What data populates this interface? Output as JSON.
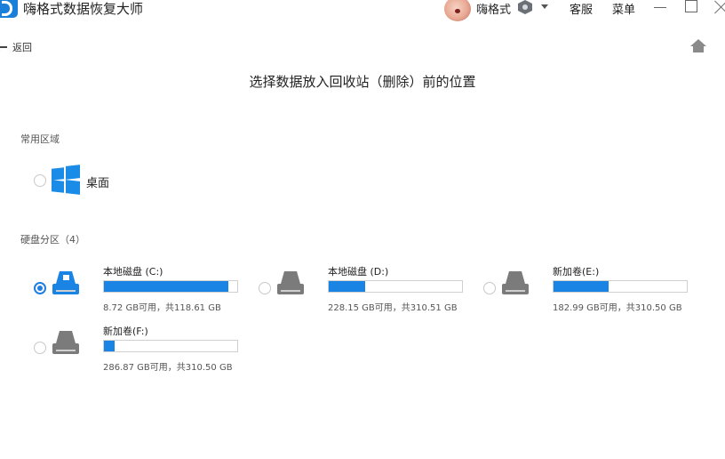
{
  "app": {
    "title": "嗨格式数据恢复大师"
  },
  "header": {
    "user_name": "嗨格式",
    "service_label": "客服",
    "menu_label": "菜单"
  },
  "nav": {
    "back_label": "返回"
  },
  "page": {
    "title": "选择数据放入回收站（删除）前的位置"
  },
  "sections": {
    "common_label": "常用区域",
    "disks_label": "硬盘分区（4）"
  },
  "common": {
    "desktop_label": "桌面"
  },
  "drives": [
    {
      "name": "本地磁盘 (C:)",
      "info": "8.72 GB可用，共118.61 GB",
      "used_fraction": 0.93,
      "selected": true,
      "icon": "system-drive-icon"
    },
    {
      "name": "本地磁盘 (D:)",
      "info": "228.15 GB可用，共310.51 GB",
      "used_fraction": 0.27,
      "selected": false,
      "icon": "drive-icon"
    },
    {
      "name": "新加卷(E:)",
      "info": "182.99 GB可用，共310.50 GB",
      "used_fraction": 0.41,
      "selected": false,
      "icon": "drive-icon"
    },
    {
      "name": "新加卷(F:)",
      "info": "286.87 GB可用，共310.50 GB",
      "used_fraction": 0.08,
      "selected": false,
      "icon": "drive-icon"
    }
  ],
  "colors": {
    "accent": "#1a84e4",
    "drive_gray": "#7b7b7b"
  }
}
